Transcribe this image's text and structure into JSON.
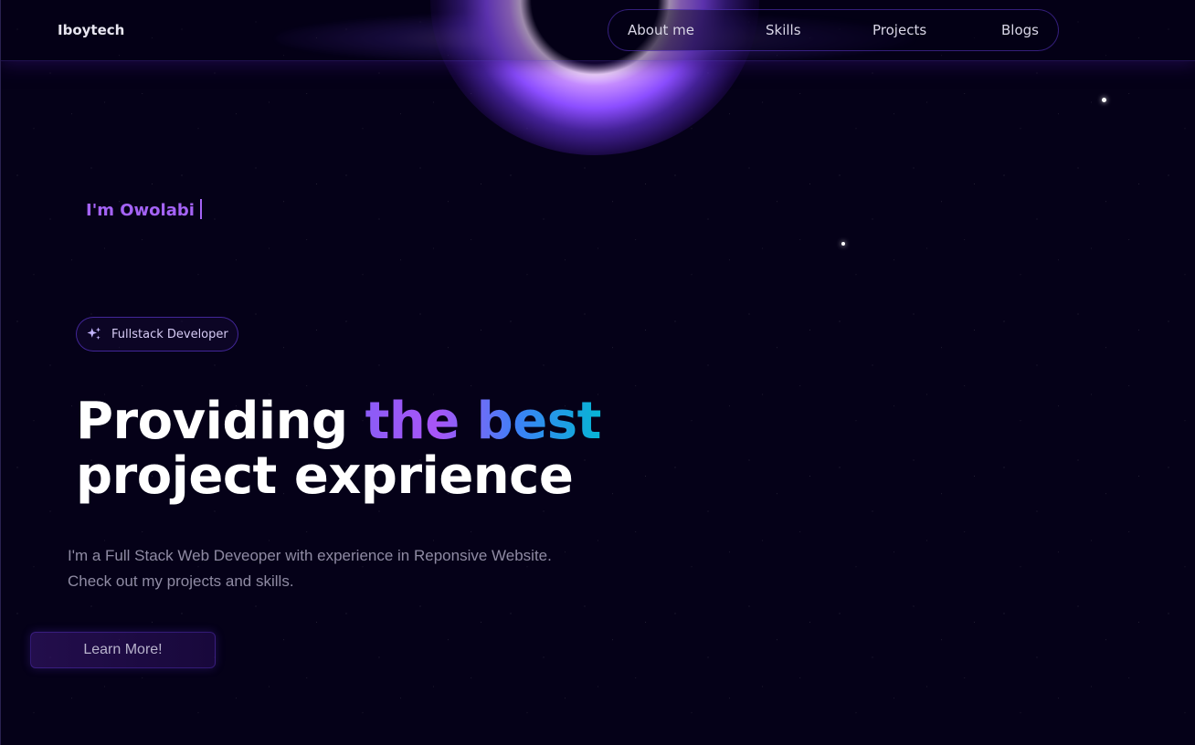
{
  "header": {
    "brand": "Iboytech",
    "nav": [
      {
        "label": "About me"
      },
      {
        "label": "Skills"
      },
      {
        "label": "Projects"
      },
      {
        "label": "Blogs"
      }
    ]
  },
  "hero": {
    "typed_text": "I'm Owolabi",
    "badge": {
      "icon": "sparkles-icon",
      "label": "Fullstack Developer"
    },
    "headline": {
      "part1": "Providing ",
      "highlight": "the best",
      "line2": "project exprience"
    },
    "description_line1": "I'm a Full Stack Web Deveoper with experience in Reponsive Website.",
    "description_line2": "Check out my projects and skills.",
    "cta_label": "Learn More!"
  },
  "colors": {
    "background": "#050118",
    "accent": "#a463f5",
    "gradient_start": "#8b5cf6",
    "gradient_end": "#06b6d4"
  }
}
